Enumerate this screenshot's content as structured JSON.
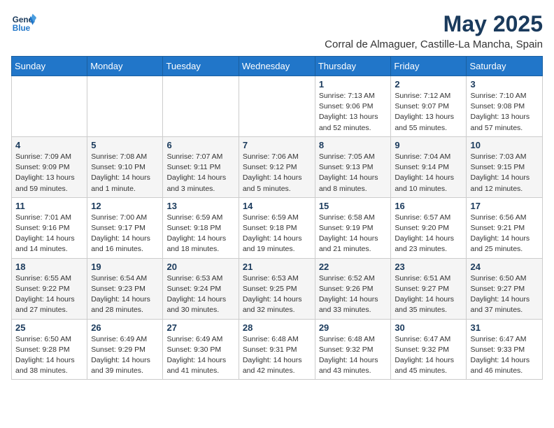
{
  "logo": {
    "line1": "General",
    "line2": "Blue"
  },
  "title": "May 2025",
  "location": "Corral de Almaguer, Castille-La Mancha, Spain",
  "weekdays": [
    "Sunday",
    "Monday",
    "Tuesday",
    "Wednesday",
    "Thursday",
    "Friday",
    "Saturday"
  ],
  "weeks": [
    [
      {
        "day": "",
        "info": ""
      },
      {
        "day": "",
        "info": ""
      },
      {
        "day": "",
        "info": ""
      },
      {
        "day": "",
        "info": ""
      },
      {
        "day": "1",
        "info": "Sunrise: 7:13 AM\nSunset: 9:06 PM\nDaylight: 13 hours and 52 minutes."
      },
      {
        "day": "2",
        "info": "Sunrise: 7:12 AM\nSunset: 9:07 PM\nDaylight: 13 hours and 55 minutes."
      },
      {
        "day": "3",
        "info": "Sunrise: 7:10 AM\nSunset: 9:08 PM\nDaylight: 13 hours and 57 minutes."
      }
    ],
    [
      {
        "day": "4",
        "info": "Sunrise: 7:09 AM\nSunset: 9:09 PM\nDaylight: 13 hours and 59 minutes."
      },
      {
        "day": "5",
        "info": "Sunrise: 7:08 AM\nSunset: 9:10 PM\nDaylight: 14 hours and 1 minute."
      },
      {
        "day": "6",
        "info": "Sunrise: 7:07 AM\nSunset: 9:11 PM\nDaylight: 14 hours and 3 minutes."
      },
      {
        "day": "7",
        "info": "Sunrise: 7:06 AM\nSunset: 9:12 PM\nDaylight: 14 hours and 5 minutes."
      },
      {
        "day": "8",
        "info": "Sunrise: 7:05 AM\nSunset: 9:13 PM\nDaylight: 14 hours and 8 minutes."
      },
      {
        "day": "9",
        "info": "Sunrise: 7:04 AM\nSunset: 9:14 PM\nDaylight: 14 hours and 10 minutes."
      },
      {
        "day": "10",
        "info": "Sunrise: 7:03 AM\nSunset: 9:15 PM\nDaylight: 14 hours and 12 minutes."
      }
    ],
    [
      {
        "day": "11",
        "info": "Sunrise: 7:01 AM\nSunset: 9:16 PM\nDaylight: 14 hours and 14 minutes."
      },
      {
        "day": "12",
        "info": "Sunrise: 7:00 AM\nSunset: 9:17 PM\nDaylight: 14 hours and 16 minutes."
      },
      {
        "day": "13",
        "info": "Sunrise: 6:59 AM\nSunset: 9:18 PM\nDaylight: 14 hours and 18 minutes."
      },
      {
        "day": "14",
        "info": "Sunrise: 6:59 AM\nSunset: 9:18 PM\nDaylight: 14 hours and 19 minutes."
      },
      {
        "day": "15",
        "info": "Sunrise: 6:58 AM\nSunset: 9:19 PM\nDaylight: 14 hours and 21 minutes."
      },
      {
        "day": "16",
        "info": "Sunrise: 6:57 AM\nSunset: 9:20 PM\nDaylight: 14 hours and 23 minutes."
      },
      {
        "day": "17",
        "info": "Sunrise: 6:56 AM\nSunset: 9:21 PM\nDaylight: 14 hours and 25 minutes."
      }
    ],
    [
      {
        "day": "18",
        "info": "Sunrise: 6:55 AM\nSunset: 9:22 PM\nDaylight: 14 hours and 27 minutes."
      },
      {
        "day": "19",
        "info": "Sunrise: 6:54 AM\nSunset: 9:23 PM\nDaylight: 14 hours and 28 minutes."
      },
      {
        "day": "20",
        "info": "Sunrise: 6:53 AM\nSunset: 9:24 PM\nDaylight: 14 hours and 30 minutes."
      },
      {
        "day": "21",
        "info": "Sunrise: 6:53 AM\nSunset: 9:25 PM\nDaylight: 14 hours and 32 minutes."
      },
      {
        "day": "22",
        "info": "Sunrise: 6:52 AM\nSunset: 9:26 PM\nDaylight: 14 hours and 33 minutes."
      },
      {
        "day": "23",
        "info": "Sunrise: 6:51 AM\nSunset: 9:27 PM\nDaylight: 14 hours and 35 minutes."
      },
      {
        "day": "24",
        "info": "Sunrise: 6:50 AM\nSunset: 9:27 PM\nDaylight: 14 hours and 37 minutes."
      }
    ],
    [
      {
        "day": "25",
        "info": "Sunrise: 6:50 AM\nSunset: 9:28 PM\nDaylight: 14 hours and 38 minutes."
      },
      {
        "day": "26",
        "info": "Sunrise: 6:49 AM\nSunset: 9:29 PM\nDaylight: 14 hours and 39 minutes."
      },
      {
        "day": "27",
        "info": "Sunrise: 6:49 AM\nSunset: 9:30 PM\nDaylight: 14 hours and 41 minutes."
      },
      {
        "day": "28",
        "info": "Sunrise: 6:48 AM\nSunset: 9:31 PM\nDaylight: 14 hours and 42 minutes."
      },
      {
        "day": "29",
        "info": "Sunrise: 6:48 AM\nSunset: 9:32 PM\nDaylight: 14 hours and 43 minutes."
      },
      {
        "day": "30",
        "info": "Sunrise: 6:47 AM\nSunset: 9:32 PM\nDaylight: 14 hours and 45 minutes."
      },
      {
        "day": "31",
        "info": "Sunrise: 6:47 AM\nSunset: 9:33 PM\nDaylight: 14 hours and 46 minutes."
      }
    ]
  ]
}
